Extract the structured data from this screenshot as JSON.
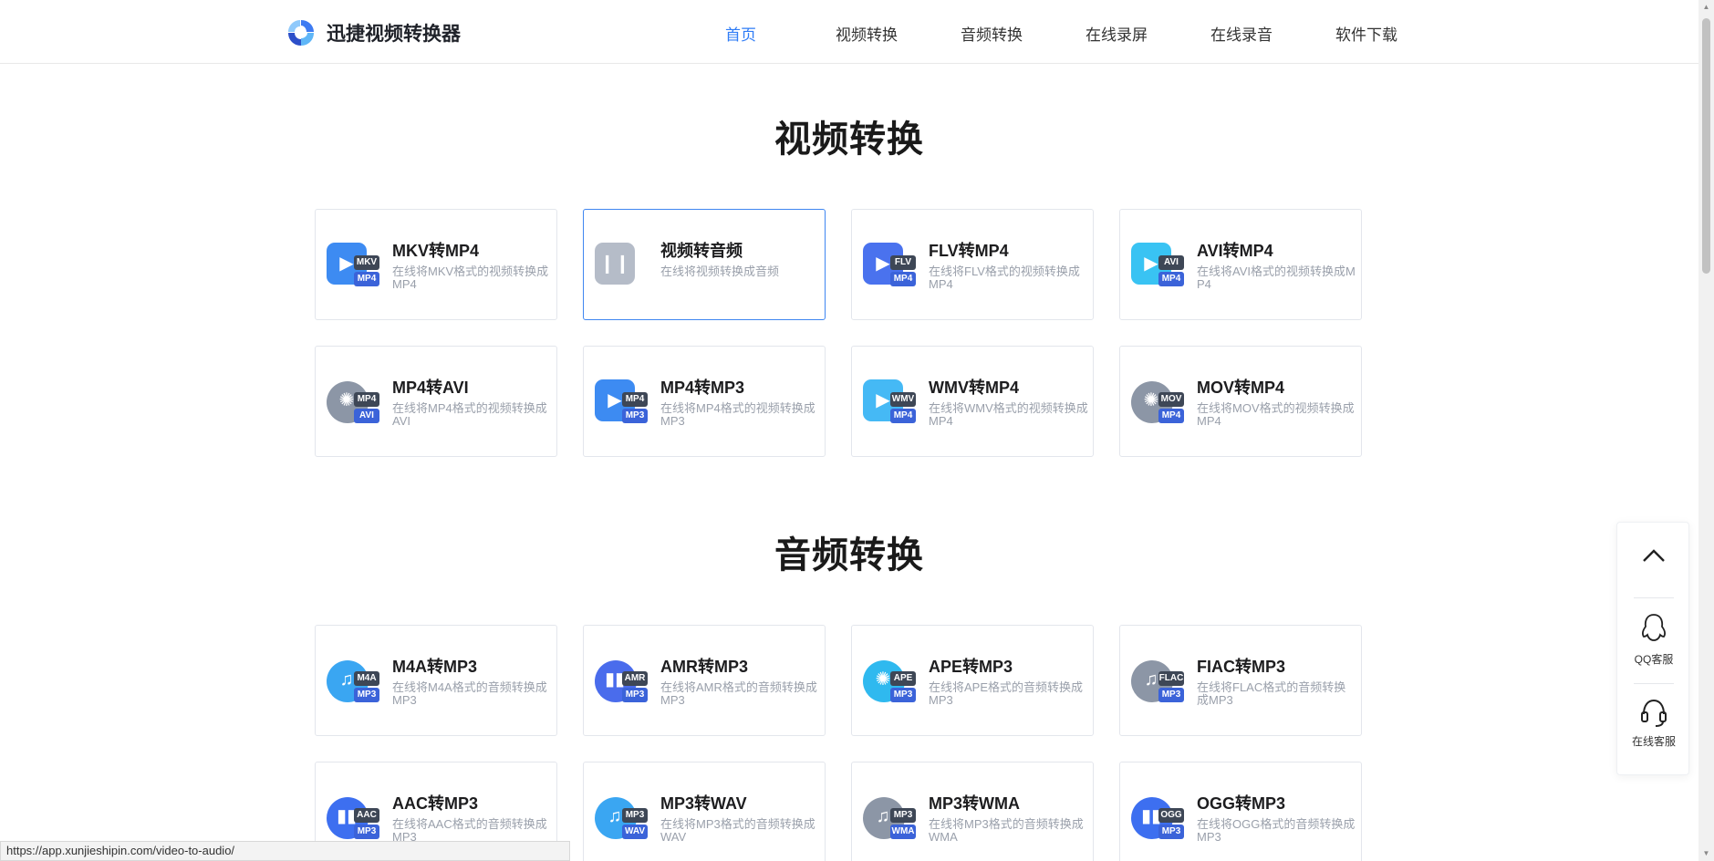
{
  "header": {
    "logo_text": "迅捷视频转换器",
    "nav": [
      {
        "label": "首页",
        "active": true
      },
      {
        "label": "视频转换",
        "active": false
      },
      {
        "label": "音频转换",
        "active": false
      },
      {
        "label": "在线录屏",
        "active": false
      },
      {
        "label": "在线录音",
        "active": false
      },
      {
        "label": "软件下载",
        "active": false
      }
    ]
  },
  "video_section": {
    "title": "视频转换",
    "cards": [
      {
        "title": "MKV转MP4",
        "desc": "在线将MKV格式的视频转换成MP4",
        "badge_top": "MKV",
        "badge_bottom": "MP4",
        "icon": "film-icon",
        "color": "#3d8bf2"
      },
      {
        "title": "视频转音频",
        "desc": "在线将视频转换成音频",
        "badge_top": "",
        "badge_bottom": "",
        "icon": "audio-wave-icon",
        "color": "#b5bcc8"
      },
      {
        "title": "FLV转MP4",
        "desc": "在线将FLV格式的视频转换成MP4",
        "badge_top": "FLV",
        "badge_bottom": "MP4",
        "icon": "film-icon",
        "color": "#4a72ee"
      },
      {
        "title": "AVI转MP4",
        "desc": "在线将AVI格式的视频转换成MP4",
        "badge_top": "AVI",
        "badge_bottom": "MP4",
        "icon": "play-icon",
        "color": "#39c3f3"
      },
      {
        "title": "MP4转AVI",
        "desc": "在线将MP4格式的视频转换成AVI",
        "badge_top": "MP4",
        "badge_bottom": "AVI",
        "icon": "reel-icon",
        "color": "#8c96a6"
      },
      {
        "title": "MP4转MP3",
        "desc": "在线将MP4格式的视频转换成MP3",
        "badge_top": "MP4",
        "badge_bottom": "MP3",
        "icon": "film-icon",
        "color": "#3d8bf2"
      },
      {
        "title": "WMV转MP4",
        "desc": "在线将WMV格式的视频转换成MP4",
        "badge_top": "WMV",
        "badge_bottom": "MP4",
        "icon": "film-icon",
        "color": "#45b9f5"
      },
      {
        "title": "MOV转MP4",
        "desc": "在线将MOV格式的视频转换成MP4",
        "badge_top": "MOV",
        "badge_bottom": "MP4",
        "icon": "reel-icon",
        "color": "#8c96a6"
      }
    ]
  },
  "audio_section": {
    "title": "音频转换",
    "cards": [
      {
        "title": "M4A转MP3",
        "desc": "在线将M4A格式的音频转换成MP3",
        "badge_top": "M4A",
        "badge_bottom": "MP3",
        "icon": "music-note-icon",
        "color": "#3aa6f2"
      },
      {
        "title": "AMR转MP3",
        "desc": "在线将AMR格式的音频转换成MP3",
        "badge_top": "AMR",
        "badge_bottom": "MP3",
        "icon": "audio-bars-icon",
        "color": "#4a6cec"
      },
      {
        "title": "APE转MP3",
        "desc": "在线将APE格式的音频转换成MP3",
        "badge_top": "APE",
        "badge_bottom": "MP3",
        "icon": "reel-icon",
        "color": "#2fb9ef"
      },
      {
        "title": "FIAC转MP3",
        "desc": "在线将FLAC格式的音频转换成MP3",
        "badge_top": "FLAC",
        "badge_bottom": "MP3",
        "icon": "music-note-icon",
        "color": "#8c96a6"
      },
      {
        "title": "AAC转MP3",
        "desc": "在线将AAC格式的音频转换成MP3",
        "badge_top": "AAC",
        "badge_bottom": "MP3",
        "icon": "audio-bars-icon",
        "color": "#3d6ff0"
      },
      {
        "title": "MP3转WAV",
        "desc": "在线将MP3格式的音频转换成WAV",
        "badge_top": "MP3",
        "badge_bottom": "WAV",
        "icon": "music-note-icon",
        "color": "#3aa6f2"
      },
      {
        "title": "MP3转WMA",
        "desc": "在线将MP3格式的音频转换成WMA",
        "badge_top": "MP3",
        "badge_bottom": "WMA",
        "icon": "music-note-icon",
        "color": "#8c96a6"
      },
      {
        "title": "OGG转MP3",
        "desc": "在线将OGG格式的音频转换成MP3",
        "badge_top": "OGG",
        "badge_bottom": "MP3",
        "icon": "audio-bars-icon",
        "color": "#3d6ff0"
      }
    ]
  },
  "float_bar": {
    "qq_label": "QQ客服",
    "online_label": "在线客服"
  },
  "status_url": "https://app.xunjieshipin.com/video-to-audio/",
  "accent_color": "#2f7cf6"
}
